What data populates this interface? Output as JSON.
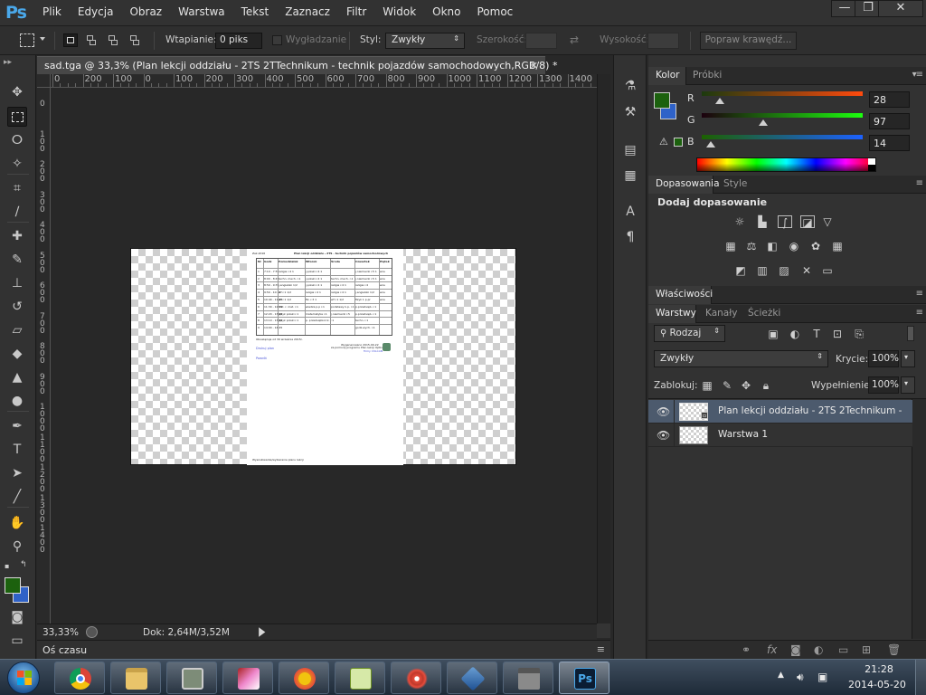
{
  "app": {
    "logo": "Ps"
  },
  "menu": [
    "Plik",
    "Edycja",
    "Obraz",
    "Warstwa",
    "Tekst",
    "Zaznacz",
    "Filtr",
    "Widok",
    "Okno",
    "Pomoc"
  ],
  "window_controls": {
    "minimize": "—",
    "restore": "❐",
    "close": "✕"
  },
  "options": {
    "feather_label": "Wtapianie:",
    "feather_value": "0 piks",
    "antialias_label": "Wygładzanie",
    "style_label": "Styl:",
    "style_value": "Zwykły",
    "width_label": "Szerokość:",
    "height_label": "Wysokość:",
    "refine_button": "Popraw krawędź..."
  },
  "document": {
    "tab_title": "sad.tga @ 33,3% (Plan lekcji oddziału - 2TS 2TTechnikum - technik pojazdów samochodowych,RGB/8) *",
    "close": "✕",
    "ruler_h": [
      "0",
      "200",
      "100",
      "0",
      "100",
      "200",
      "300",
      "400",
      "500",
      "600",
      "700",
      "800",
      "900",
      "1000",
      "1100",
      "1200",
      "1300",
      "1400",
      "15"
    ],
    "ruler_v": [
      "0",
      "1 0 0",
      "2 0 0",
      "3 0 0",
      "4 0 0",
      "5 0 0",
      "6 0 0",
      "7 0 0",
      "8 0 0",
      "9 0 0",
      "1 0 0 0",
      "1 1 0 0",
      "1 2 0 0",
      "1 3 0 0",
      "1 4 0 0"
    ],
    "page": {
      "header_left": "Zak.2016",
      "header_title": "Plan lekcji oddziału - 2TS - technik pojazdów samochodowych",
      "columns": [
        "Nr",
        "Godz",
        "Poniedziałek",
        "Wtorek",
        "Środa",
        "Czwartek",
        "Piątek"
      ],
      "rows": [
        {
          "nr": "1",
          "godz": "7:10 - 7:55",
          "cells": [
            "religia r.4 1",
            "j.polski r.4 1",
            "",
            "j.niemiecki r.5 1",
            "wos"
          ]
        },
        {
          "nr": "2",
          "godz": "8:00 - 8:45",
          "cells": [
            "techn. mech. r.1",
            "j.polski r.4 1",
            "techn. mech. r.1",
            "j.niemiecki r.5 1",
            "wos"
          ]
        },
        {
          "nr": "3",
          "godz": "8:50 - 9:35",
          "cells": [
            "j.angielski 1/2",
            "j.polski r.4 1",
            "religia r.4 1",
            "religia r.4",
            "wos"
          ]
        },
        {
          "nr": "4",
          "godz": "9:50 - 10:35",
          "cells": [
            "wf r.1 1/2",
            "religia r.4 1",
            "religia r.4 1",
            "j.angielski 1/2",
            "wos"
          ]
        },
        {
          "nr": "5",
          "godz": "10:40 - 11:25",
          "cells": [
            "wf r.1 1/2",
            "fiz. r.3 1",
            "wf r.1 1/2",
            "fizyk 1 p.pr",
            "wos"
          ]
        },
        {
          "nr": "6",
          "godz": "11:30 - 12:15",
          "cells": [
            "hist. r. mat. r.1",
            "wiedza p.p r.1",
            "podstawy k.p. r.1",
            "p.przedsięb. r.1",
            ""
          ]
        },
        {
          "nr": "7",
          "godz": "12:20 - 13:05",
          "cells": [
            "język polski r.1",
            "matematyka r.1",
            "j.niemiecki r.5",
            "p.przedsięb. r.1",
            ""
          ]
        },
        {
          "nr": "8",
          "godz": "13:10 - 13:55",
          "cells": [
            "język polski r.1",
            "p. przedsiębiorcz. r.1",
            "",
            "techn. r.1",
            ""
          ]
        },
        {
          "nr": "9",
          "godz": "14:00 - 14:45",
          "cells": [
            "",
            "",
            "",
            "godz.wych. r.1",
            ""
          ]
        }
      ],
      "note": "Obowiązuje od 30 września 2015r.",
      "link_left1": "Drukuj plan",
      "link_left2": "Powrót",
      "right_line1": "Wygenerowano 2015-09-22",
      "right_line2": "za pomocą programu Plan lekcji Optivum",
      "right_line3": "firmy VULCAN",
      "footer": "Wyszukiwarka/wybieranie planu lekcji"
    }
  },
  "status": {
    "zoom": "33,33%",
    "doc_size": "Dok: 2,64M/3,52M"
  },
  "timeline": {
    "label": "Oś czasu"
  },
  "panels": {
    "color": {
      "tabs": [
        "Kolor",
        "Próbki"
      ],
      "fg_color": "#1c610e",
      "bg_color": "#2f62c8",
      "r_label": "R",
      "r_value": "28",
      "g_label": "G",
      "g_value": "97",
      "b_label": "B",
      "b_value": "14"
    },
    "adjustments": {
      "tabs": [
        "Dopasowania",
        "Style"
      ],
      "title": "Dodaj dopasowanie"
    },
    "properties": {
      "tabs": [
        "Właściwości"
      ]
    },
    "layers": {
      "tabs": [
        "Warstwy",
        "Kanały",
        "Ścieżki"
      ],
      "filter_value": "Rodzaj",
      "blend_value": "Zwykły",
      "opacity_label": "Krycie:",
      "opacity_value": "100%",
      "lock_label": "Zablokuj:",
      "fill_label": "Wypełnienie:",
      "fill_value": "100%",
      "items": [
        {
          "name": "Plan lekcji oddziału - 2TS 2Technikum - te...",
          "selected": true
        },
        {
          "name": "Warstwa 1",
          "selected": false
        }
      ]
    }
  },
  "taskbar": {
    "time": "21:28",
    "date": "2014-05-20",
    "apps": [
      "chrome",
      "explorer",
      "system-monitor",
      "game",
      "sunflower",
      "notepad-plus",
      "scribble",
      "virtualbox",
      "lock-app",
      "photoshop"
    ]
  }
}
